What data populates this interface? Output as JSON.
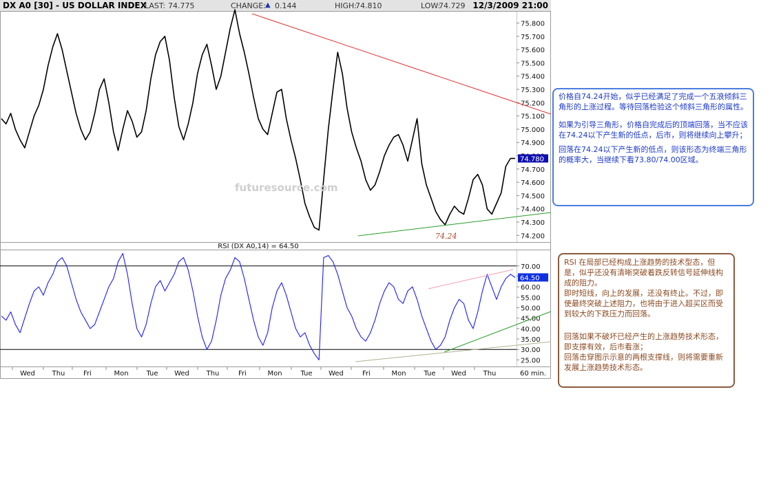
{
  "header": {
    "title": "DX A0 [30] - US DOLLAR INDEX",
    "last_label": "LAST:",
    "last_value": "74.775",
    "change_label": "CHANGE:",
    "change_arrow": "▲",
    "change_value": "0.144",
    "high_label": "HIGH:",
    "high_value": "74.810",
    "low_label": "LOW:",
    "low_value": "74.729",
    "datetime": "12/3/2009 21:00"
  },
  "watermark": "futuresource.com",
  "chart_data": [
    {
      "type": "line",
      "name": "price",
      "y_ticks": [
        "75.800",
        "75.700",
        "75.600",
        "75.500",
        "75.400",
        "75.300",
        "75.200",
        "75.100",
        "75.000",
        "74.900",
        "74.800",
        "74.700",
        "74.600",
        "74.500",
        "74.400",
        "74.300",
        "74.200"
      ],
      "ylim": [
        74.15,
        75.87
      ],
      "current_value_label": "74.780",
      "current_value": 74.78,
      "low_annotation": "74.24",
      "series": [
        {
          "values": [
            75.08,
            75.04,
            75.12,
            75.0,
            74.92,
            74.86,
            74.98,
            75.1,
            75.18,
            75.3,
            75.48,
            75.62,
            75.72,
            75.6,
            75.44,
            75.28,
            75.12,
            75.0,
            74.92,
            74.98,
            75.12,
            75.3,
            75.38,
            75.2,
            74.98,
            74.84,
            75.0,
            75.14,
            75.06,
            74.94,
            74.98,
            75.14,
            75.38,
            75.56,
            75.66,
            75.7,
            75.52,
            75.24,
            75.02,
            74.92,
            75.04,
            75.2,
            75.42,
            75.56,
            75.64,
            75.48,
            75.3,
            75.4,
            75.58,
            75.76,
            75.9,
            75.72,
            75.58,
            75.42,
            75.24,
            75.08,
            75.0,
            74.96,
            75.12,
            75.28,
            75.3,
            75.08,
            74.92,
            74.78,
            74.62,
            74.44,
            74.34,
            74.26,
            74.24,
            74.62,
            75.0,
            75.3,
            75.58,
            75.42,
            75.16,
            74.98,
            74.86,
            74.76,
            74.62,
            74.54,
            74.58,
            74.68,
            74.8,
            74.88,
            74.94,
            74.96,
            74.88,
            74.76,
            74.92,
            75.08,
            74.74,
            74.58,
            74.48,
            74.38,
            74.32,
            74.28,
            74.36,
            74.42,
            74.38,
            74.36,
            74.48,
            74.62,
            74.66,
            74.58,
            74.4,
            74.36,
            74.44,
            74.52,
            74.72,
            74.78,
            74.78
          ]
        }
      ]
    },
    {
      "type": "line",
      "name": "rsi",
      "title": "RSI (DX A0,14) = 64.50",
      "y_ticks": [
        "70.00",
        "65.00",
        "60.00",
        "55.00",
        "50.00",
        "45.00",
        "40.00",
        "35.00",
        "30.00",
        "25.00"
      ],
      "ylim": [
        22.5,
        77.5
      ],
      "reference_lines": [
        70,
        30
      ],
      "current_value_label": "64.50",
      "current_value": 64.5,
      "series": [
        {
          "values": [
            46,
            44,
            48,
            42,
            38,
            45,
            52,
            58,
            60,
            56,
            62,
            66,
            72,
            74,
            70,
            62,
            54,
            48,
            44,
            40,
            42,
            48,
            54,
            60,
            64,
            72,
            76,
            66,
            52,
            40,
            36,
            42,
            52,
            60,
            63,
            58,
            62,
            66,
            72,
            74,
            68,
            58,
            46,
            36,
            30,
            34,
            44,
            56,
            64,
            68,
            74,
            72,
            64,
            54,
            44,
            36,
            32,
            38,
            50,
            58,
            62,
            56,
            48,
            40,
            36,
            38,
            32,
            28,
            25,
            74,
            75,
            72,
            66,
            58,
            50,
            46,
            40,
            36,
            34,
            38,
            44,
            52,
            58,
            62,
            60,
            54,
            52,
            58,
            60,
            54,
            46,
            40,
            34,
            30,
            32,
            36,
            44,
            50,
            54,
            52,
            44,
            40,
            48,
            58,
            66,
            60,
            54,
            60,
            64,
            66,
            64.5
          ]
        }
      ],
      "x_tick_labels": [
        "Wed",
        "Thu",
        "Fri",
        "Mon",
        "Tue",
        "Wed",
        "Thu",
        "Fri",
        "Mon",
        "Tue",
        "Wed",
        "Fri",
        "Mon",
        "Tue",
        "Wed",
        "Thu",
        "60 min."
      ]
    }
  ],
  "annotations": {
    "blue": {
      "p1": "价格自74.24开始，似乎已经满足了完成一个五浪倾斜三角形的上涨过程。等待回落检验这个倾斜三角形的属性。",
      "p2": "如果为引导三角形，价格自完成后的顶端回落，当不应该在74.24以下产生新的低点，后市，则将继续向上攀升；",
      "p3": "回落在74.24以下产生新的低点，则该形态为终端三角形的概率大，当继续下看73.80/74.00区域。"
    },
    "brown": {
      "p1": "RSI 在局部已经构成上涨趋势的技术型态，但是，似乎还没有清晰突破着跌反转信号延伸线构成的阻力。",
      "p2": "即时短线，向上的发展，还没有终止。不过，即使最终突破上述阻力，也将由于进入超买区而受到较大的下跌压力而回落。",
      "p3": "回落如果不破坏已经产生的上涨趋势技术形态，即支撑有效，后市看涨；",
      "p4": "回落击穿图示示意的两根支撑线，则将需要重新发展上涨趋势技术形态。"
    }
  },
  "colors": {
    "price_line": "#000000",
    "rsi_line": "#1a1aff",
    "resistance_line": "#e03030",
    "support_line": "#2a9a2a",
    "rsi_upper_trend": "#f0a0b0",
    "rsi_lower_support": "#b0b090",
    "current_badge": "#1010b0",
    "annot_blue": "#4a7de0",
    "annot_brown": "#8b5a3c"
  }
}
